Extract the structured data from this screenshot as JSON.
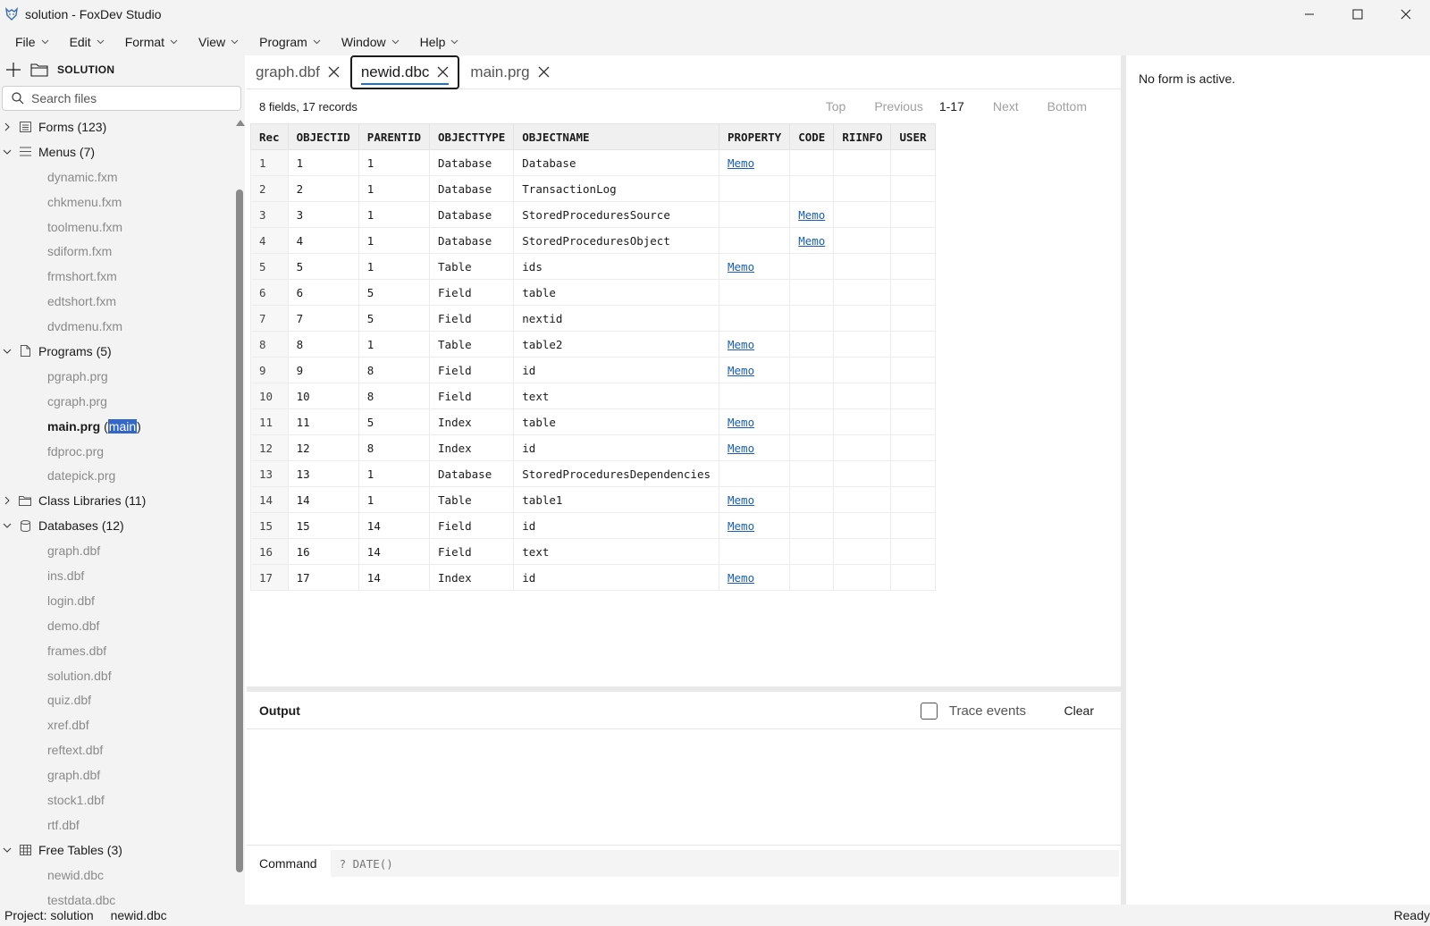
{
  "window": {
    "title": "solution - FoxDev Studio"
  },
  "menu": [
    {
      "label": "File"
    },
    {
      "label": "Edit"
    },
    {
      "label": "Format"
    },
    {
      "label": "View"
    },
    {
      "label": "Program"
    },
    {
      "label": "Window"
    },
    {
      "label": "Help"
    }
  ],
  "sidebar": {
    "header": "SOLUTION",
    "search_placeholder": "Search files",
    "groups": {
      "forms": {
        "label": "Forms (123)",
        "expanded": false
      },
      "menus": {
        "label": "Menus (7)",
        "expanded": true,
        "items": [
          "dynamic.fxm",
          "chkmenu.fxm",
          "toolmenu.fxm",
          "sdiform.fxm",
          "frmshort.fxm",
          "edtshort.fxm",
          "dvdmenu.fxm"
        ]
      },
      "programs": {
        "label": "Programs (5)",
        "expanded": true,
        "items": [
          "pgraph.prg",
          "cgraph.prg",
          "main.prg",
          "fdproc.prg",
          "datepick.prg"
        ],
        "active_item": "main.prg",
        "main_tag_open": "(",
        "main_tag": "main",
        "main_tag_close": ")"
      },
      "classlibs": {
        "label": "Class Libraries (11)",
        "expanded": false
      },
      "databases": {
        "label": "Databases (12)",
        "expanded": true,
        "items": [
          "graph.dbf",
          "ins.dbf",
          "login.dbf",
          "demo.dbf",
          "frames.dbf",
          "solution.dbf",
          "quiz.dbf",
          "xref.dbf",
          "reftext.dbf",
          "graph.dbf",
          "stock1.dbf",
          "rtf.dbf"
        ]
      },
      "freetables": {
        "label": "Free Tables (3)",
        "expanded": true,
        "items": [
          "newid.dbc",
          "testdata.dbc"
        ]
      }
    }
  },
  "tabs": [
    {
      "label": "graph.dbf",
      "active": false
    },
    {
      "label": "newid.dbc",
      "active": true
    },
    {
      "label": "main.prg",
      "active": false
    }
  ],
  "grid": {
    "summary": "8 fields, 17 records",
    "pager": {
      "top": "Top",
      "previous": "Previous",
      "range": "1-17",
      "next": "Next",
      "bottom": "Bottom"
    },
    "columns": [
      "Rec",
      "OBJECTID",
      "PARENTID",
      "OBJECTTYPE",
      "OBJECTNAME",
      "PROPERTY",
      "CODE",
      "RIINFO",
      "USER"
    ],
    "rows": [
      [
        "1",
        "1",
        "1",
        "Database",
        "Database",
        "Memo",
        "",
        "",
        ""
      ],
      [
        "2",
        "2",
        "1",
        "Database",
        "TransactionLog",
        "",
        "",
        "",
        ""
      ],
      [
        "3",
        "3",
        "1",
        "Database",
        "StoredProceduresSource",
        "",
        "Memo",
        "",
        ""
      ],
      [
        "4",
        "4",
        "1",
        "Database",
        "StoredProceduresObject",
        "",
        "Memo",
        "",
        ""
      ],
      [
        "5",
        "5",
        "1",
        "Table",
        "ids",
        "Memo",
        "",
        "",
        ""
      ],
      [
        "6",
        "6",
        "5",
        "Field",
        "table",
        "",
        "",
        "",
        ""
      ],
      [
        "7",
        "7",
        "5",
        "Field",
        "nextid",
        "",
        "",
        "",
        ""
      ],
      [
        "8",
        "8",
        "1",
        "Table",
        "table2",
        "Memo",
        "",
        "",
        ""
      ],
      [
        "9",
        "9",
        "8",
        "Field",
        "id",
        "Memo",
        "",
        "",
        ""
      ],
      [
        "10",
        "10",
        "8",
        "Field",
        "text",
        "",
        "",
        "",
        ""
      ],
      [
        "11",
        "11",
        "5",
        "Index",
        "table",
        "Memo",
        "",
        "",
        ""
      ],
      [
        "12",
        "12",
        "8",
        "Index",
        "id",
        "Memo",
        "",
        "",
        ""
      ],
      [
        "13",
        "13",
        "1",
        "Database",
        "StoredProceduresDependencies",
        "",
        "",
        "",
        ""
      ],
      [
        "14",
        "14",
        "1",
        "Table",
        "table1",
        "Memo",
        "",
        "",
        ""
      ],
      [
        "15",
        "15",
        "14",
        "Field",
        "id",
        "Memo",
        "",
        "",
        ""
      ],
      [
        "16",
        "16",
        "14",
        "Field",
        "text",
        "",
        "",
        "",
        ""
      ],
      [
        "17",
        "17",
        "14",
        "Index",
        "id",
        "Memo",
        "",
        "",
        ""
      ]
    ]
  },
  "output": {
    "title": "Output",
    "trace_label": "Trace events",
    "trace_checked": false,
    "clear_label": "Clear"
  },
  "command": {
    "label": "Command",
    "placeholder": "? DATE()"
  },
  "properties": {
    "message": "No form is active."
  },
  "status": {
    "project": "Project: solution",
    "file": "newid.dbc",
    "state": "Ready"
  },
  "colors": {
    "accent": "#1e6fd6",
    "link": "#1a5fb4",
    "selection": "#3367c7",
    "chrome": "#f3f3f3"
  }
}
